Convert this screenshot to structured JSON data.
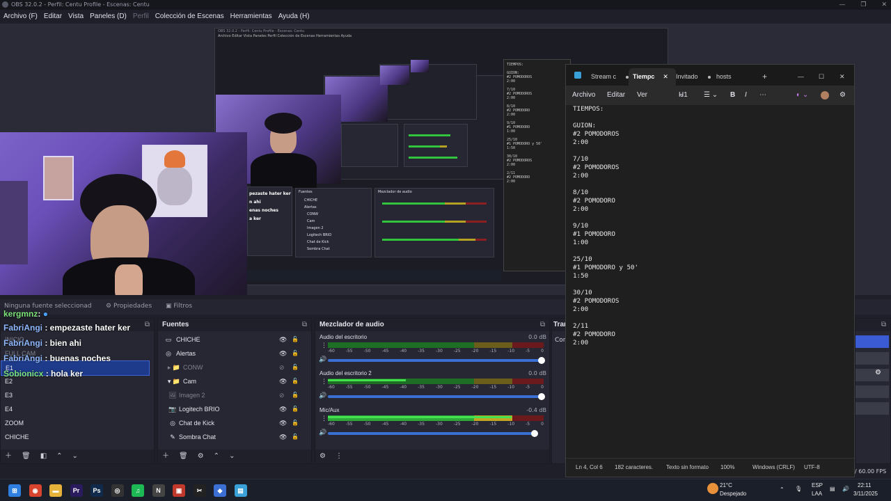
{
  "obs": {
    "title": "OBS 32.0.2 - Perfil: Centu Profile - Escenas: Centu",
    "menu": [
      "Archivo (F)",
      "Editar",
      "Vista",
      "Paneles (D)",
      "Perfil",
      "Colección de Escenas",
      "Herramientas",
      "Ayuda (H)"
    ],
    "window_controls": [
      "—",
      "❐",
      "✕"
    ]
  },
  "source_bar": {
    "no_source": "Ninguna fuente seleccionad",
    "properties": "Propiedades",
    "filters": "Filtros"
  },
  "chat": [
    {
      "user": "kergmnz",
      "msg": ":",
      "color": "u-green"
    },
    {
      "user": "FabriAngi",
      "msg": ": empezaste hater ker",
      "color": "u-blue"
    },
    {
      "user": "FabriAngi",
      "msg": ": bien ahi",
      "color": "u-blue"
    },
    {
      "user": "FabriAngi",
      "msg": ": buenas noches",
      "color": "u-blue"
    },
    {
      "user": "Sobionicx",
      "msg": ": hola ker",
      "color": "u-green"
    }
  ],
  "scenes": {
    "items": [
      "INICIO",
      "FULL CAM",
      "E1",
      "E2",
      "E3",
      "E4",
      "ZOOM",
      "CHICHE"
    ]
  },
  "sources": {
    "title": "Fuentes",
    "items": [
      {
        "label": "CHICHE",
        "icon": "▭",
        "visible": "👁",
        "lock": "🔓",
        "dim": false
      },
      {
        "label": "Alertas",
        "icon": "◎",
        "visible": "👁",
        "lock": "🔓",
        "dim": false
      },
      {
        "label": "CONW",
        "icon": "▸ 📁",
        "visible": "⊘",
        "lock": "🔓",
        "dim": true
      },
      {
        "label": "Cam",
        "icon": "▾ 📁",
        "visible": "👁",
        "lock": "🔓",
        "dim": false
      },
      {
        "label": "Imagen 2",
        "icon": "🖼",
        "visible": "⊘",
        "lock": "🔓",
        "dim": true
      },
      {
        "label": "Logitech BRIO",
        "icon": "📷",
        "visible": "👁",
        "lock": "🔓",
        "dim": false
      },
      {
        "label": "Chat de Kick",
        "icon": "◎",
        "visible": "👁",
        "lock": "🔓",
        "dim": false
      },
      {
        "label": "Sombra Chat",
        "icon": "✎",
        "visible": "👁",
        "lock": "🔓",
        "dim": false
      }
    ]
  },
  "mixer": {
    "title": "Mezclador de audio",
    "channels": [
      {
        "name": "Audio del escritorio",
        "db": "0.0 dB",
        "level": 0.0
      },
      {
        "name": "Audio del escritorio 2",
        "db": "0.0 dB",
        "level": 0.36
      },
      {
        "name": "Mic/Aux",
        "db": "-0.4 dB",
        "level": 0.85
      }
    ],
    "scale": [
      "-60",
      "-55",
      "-50",
      "-45",
      "-40",
      "-35",
      "-30",
      "-25",
      "-20",
      "-15",
      "-10",
      "-5",
      "0"
    ]
  },
  "transitions": {
    "title": "Tran",
    "btn": "Con"
  },
  "status_right": "/ 60.00 FPS",
  "notepad": {
    "tabs": [
      "Stream c",
      "Tiempc",
      "Invitado",
      "hosts"
    ],
    "menu": [
      "Archivo",
      "Editar",
      "Ver"
    ],
    "heading": "H1",
    "content": "TIEMPOS:\n\nGUION:\n#2 POMODOROS\n2:00\n\n7/10\n#2 POMODOROS\n2:00\n\n8/10\n#2 POMODORO\n2:00\n\n9/10\n#1 POMODORO\n1:00\n\n25/10\n#1 POMODORO y 50'\n1:50\n\n30/10\n#2 POMODOROS\n2:00\n\n2/11\n#2 POMODORO\n2:00",
    "status": {
      "pos": "Ln 4, Col 6",
      "chars": "182 caracteres.",
      "format": "Texto sin formato",
      "zoom": "100%",
      "eol": "Windows (CRLF)",
      "enc": "UTF-8"
    }
  },
  "taskbar": {
    "apps": [
      {
        "name": "windows-start-icon",
        "glyph": "⊞",
        "color": "#2f7fe0"
      },
      {
        "name": "chrome-icon",
        "glyph": "◉",
        "color": "#d9442e"
      },
      {
        "name": "file-explorer-icon",
        "glyph": "▬",
        "color": "#e6b33a"
      },
      {
        "name": "premiere-icon",
        "glyph": "Pr",
        "color": "#2a1a5e"
      },
      {
        "name": "photoshop-icon",
        "glyph": "Ps",
        "color": "#0f2a4a"
      },
      {
        "name": "obs-icon",
        "glyph": "◎",
        "color": "#333"
      },
      {
        "name": "spotify-icon",
        "glyph": "♫",
        "color": "#1db954"
      },
      {
        "name": "notion-icon",
        "glyph": "N",
        "color": "#444"
      },
      {
        "name": "app-red-icon",
        "glyph": "▣",
        "color": "#c0392b"
      },
      {
        "name": "capcut-icon",
        "glyph": "✂",
        "color": "#222"
      },
      {
        "name": "app-blue-icon",
        "glyph": "◆",
        "color": "#3b6fd4"
      },
      {
        "name": "notepad-icon",
        "glyph": "▤",
        "color": "#3aa0d8"
      }
    ],
    "weather_temp": "21°C",
    "weather_desc": "Despejado",
    "lang1": "ESP",
    "lang2": "LAA",
    "time": "22:11",
    "date": "3/11/2025"
  }
}
